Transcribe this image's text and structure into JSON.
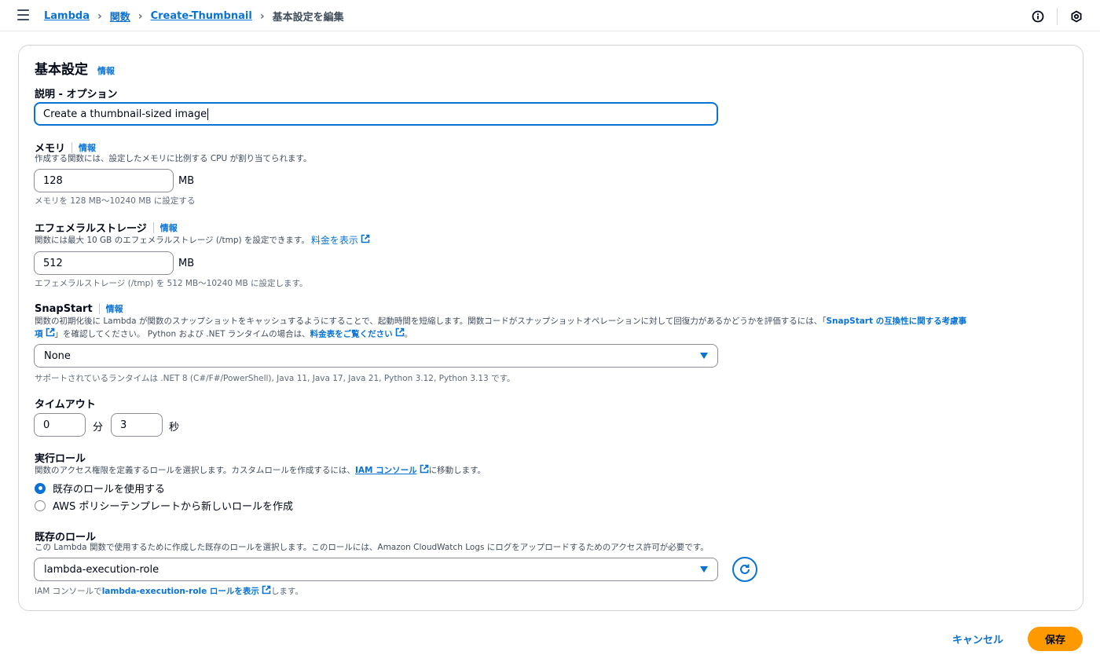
{
  "breadcrumb": {
    "lambda": "Lambda",
    "functions": "関数",
    "function_name": "Create-Thumbnail",
    "current": "基本設定を編集"
  },
  "section": {
    "title": "基本設定",
    "info": "情報"
  },
  "description": {
    "label": "説明 - オプション",
    "value": "Create a thumbnail-sized image"
  },
  "memory": {
    "label": "メモリ",
    "info": "情報",
    "desc": "作成する関数には、設定したメモリに比例する CPU が割り当てられます。",
    "value": "128",
    "unit": "MB",
    "hint": "メモリを 128 MB～10240 MB に設定する"
  },
  "ephemeral": {
    "label": "エフェメラルストレージ",
    "info": "情報",
    "desc": "関数には最大 10 GB のエフェメラルストレージ (/tmp) を設定できます。",
    "pricing_link": "料金を表示",
    "value": "512",
    "unit": "MB",
    "hint": "エフェメラルストレージ (/tmp) を 512 MB～10240 MB に設定します。"
  },
  "snapstart": {
    "label": "SnapStart",
    "info": "情報",
    "desc_part1": "関数の初期化後に Lambda が関数のスナップショットをキャッシュするようにすることで、起動時間を短縮します。関数コードがスナップショットオペレーションに対して回復力があるかどうかを評価するには、「",
    "compat_link_a": "SnapStart の互換性に関する考慮事",
    "compat_link_b": "項",
    "desc_part2": "」を確認してください。 Python および .NET ランタイムの場合は、",
    "price_link": "料金表をご覧ください",
    "desc_part3": "。",
    "selected": "None",
    "hint": "サポートされているランタイムは .NET 8 (C#/F#/PowerShell), Java 11, Java 17, Java 21, Python 3.12, Python 3.13 です。"
  },
  "timeout": {
    "label": "タイムアウト",
    "minutes": "0",
    "min_unit": "分",
    "seconds": "3",
    "sec_unit": "秒"
  },
  "exec_role": {
    "label": "実行ロール",
    "desc_part1": "関数のアクセス権限を定義するロールを選択します。カスタムロールを作成するには、",
    "iam_link": "IAM コンソール",
    "desc_part2": "に移動します。",
    "option_existing": "既存のロールを使用する",
    "option_new": "AWS ポリシーテンプレートから新しいロールを作成"
  },
  "existing_role": {
    "label": "既存のロール",
    "desc": "この Lambda 関数で使用するために作成した既存のロールを選択します。このロールには、Amazon CloudWatch Logs にログをアップロードするためのアクセス許可が必要です。",
    "selected": "lambda-execution-role",
    "hint_part1": "IAM コンソールで ",
    "hint_link": "lambda-execution-role ロールを表示",
    "hint_part2": "します。"
  },
  "footer": {
    "cancel": "キャンセル",
    "save": "保存"
  },
  "colors": {
    "accent": "#0972d3",
    "primary_button": "#ff9900"
  }
}
